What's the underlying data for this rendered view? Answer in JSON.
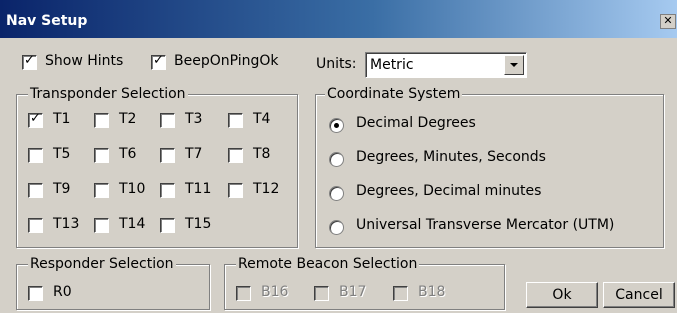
{
  "window": {
    "title": "Nav Setup",
    "close_label": "✕"
  },
  "top": {
    "show_hints": {
      "label": "Show Hints",
      "checked": true
    },
    "beep_on_ping_ok": {
      "label": "BeepOnPingOk",
      "checked": true
    },
    "units_label": "Units:",
    "units_value": "Metric"
  },
  "transponder": {
    "title": "Transponder Selection",
    "items": [
      {
        "label": "T1",
        "checked": true
      },
      {
        "label": "T5",
        "checked": false
      },
      {
        "label": "T9",
        "checked": false
      },
      {
        "label": "T13",
        "checked": false
      },
      {
        "label": "T2",
        "checked": false
      },
      {
        "label": "T6",
        "checked": false
      },
      {
        "label": "T10",
        "checked": false
      },
      {
        "label": "T14",
        "checked": false
      },
      {
        "label": "T3",
        "checked": false
      },
      {
        "label": "T7",
        "checked": false
      },
      {
        "label": "T11",
        "checked": false
      },
      {
        "label": "T15",
        "checked": false
      },
      {
        "label": "T4",
        "checked": false
      },
      {
        "label": "T8",
        "checked": false
      },
      {
        "label": "T12",
        "checked": false
      }
    ]
  },
  "coordinate": {
    "title": "Coordinate System",
    "options": [
      {
        "label": "Decimal Degrees",
        "selected": true
      },
      {
        "label": "Degrees, Minutes, Seconds",
        "selected": false
      },
      {
        "label": "Degrees, Decimal minutes",
        "selected": false
      },
      {
        "label": "Universal Transverse Mercator (UTM)",
        "selected": false
      }
    ]
  },
  "responder": {
    "title": "Responder Selection",
    "items": [
      {
        "label": "R0",
        "checked": false
      }
    ]
  },
  "beacon": {
    "title": "Remote Beacon Selection",
    "items": [
      {
        "label": "B16",
        "checked": false,
        "disabled": true
      },
      {
        "label": "B17",
        "checked": false,
        "disabled": true
      },
      {
        "label": "B18",
        "checked": false,
        "disabled": true
      }
    ]
  },
  "buttons": {
    "ok": "Ok",
    "cancel": "Cancel"
  },
  "icons": {
    "checkmark": "check-icon",
    "dropdown": "chevron-down-icon",
    "close": "close-icon"
  }
}
